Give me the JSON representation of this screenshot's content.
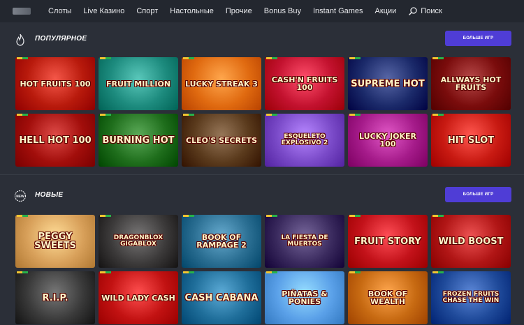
{
  "nav": {
    "items": [
      "Слоты",
      "Live Казино",
      "Спорт",
      "Настольные",
      "Прочие",
      "Bonus Buy",
      "Instant Games",
      "Акции"
    ],
    "search_label": "Поиск"
  },
  "popular": {
    "title": "ПОПУЛЯРНОЕ",
    "more_label": "БОЛЬШЕ ИГР",
    "games": [
      {
        "title": "Hot Fruits 100",
        "bg": "#b81a0c"
      },
      {
        "title": "Fruit Million",
        "bg": "#1d8b7e"
      },
      {
        "title": "Lucky Streak 3",
        "bg": "#e06a10"
      },
      {
        "title": "Cash'n Fruits 100",
        "bg": "#c3122f"
      },
      {
        "title": "Supreme Hot",
        "bg": "#1b2a6a"
      },
      {
        "title": "Allways Hot Fruits",
        "bg": "#7a0c0c"
      },
      {
        "title": "Hell Hot 100",
        "bg": "#a20e0b"
      },
      {
        "title": "Burning Hot",
        "bg": "#1f6e1c"
      },
      {
        "title": "Cleo's Secrets",
        "bg": "#5a3a1c"
      },
      {
        "title": "Esqueleto Explosivo 2",
        "bg": "#7a4ac8"
      },
      {
        "title": "Lucky Joker 100",
        "bg": "#a51b8a"
      },
      {
        "title": "Hit Slot",
        "bg": "#c81a12"
      }
    ]
  },
  "new": {
    "title": "НОВЫЕ",
    "more_label": "БОЛЬШЕ ИГР",
    "games": [
      {
        "title": "Peggy Sweets",
        "bg": "#d8a05a"
      },
      {
        "title": "Dragonblox Gigablox",
        "bg": "#3c3a3a"
      },
      {
        "title": "Book of Rampage 2",
        "bg": "#2a6e92"
      },
      {
        "title": "La Fiesta de Muertos",
        "bg": "#3a2a5e"
      },
      {
        "title": "Fruit Story",
        "bg": "#c3121a"
      },
      {
        "title": "Wild Boost",
        "bg": "#b11616"
      },
      {
        "title": "R.I.P.",
        "bg": "#3a3a3a"
      },
      {
        "title": "Wild Lady Cash",
        "bg": "#c21212"
      },
      {
        "title": "Cash Cabana",
        "bg": "#1f6e9a"
      },
      {
        "title": "Piñatas & Ponies",
        "bg": "#5aa0e8"
      },
      {
        "title": "Book of Wealth",
        "bg": "#c76a12"
      },
      {
        "title": "Frozen Fruits Chase the Win",
        "bg": "#1f4a9a"
      }
    ]
  }
}
